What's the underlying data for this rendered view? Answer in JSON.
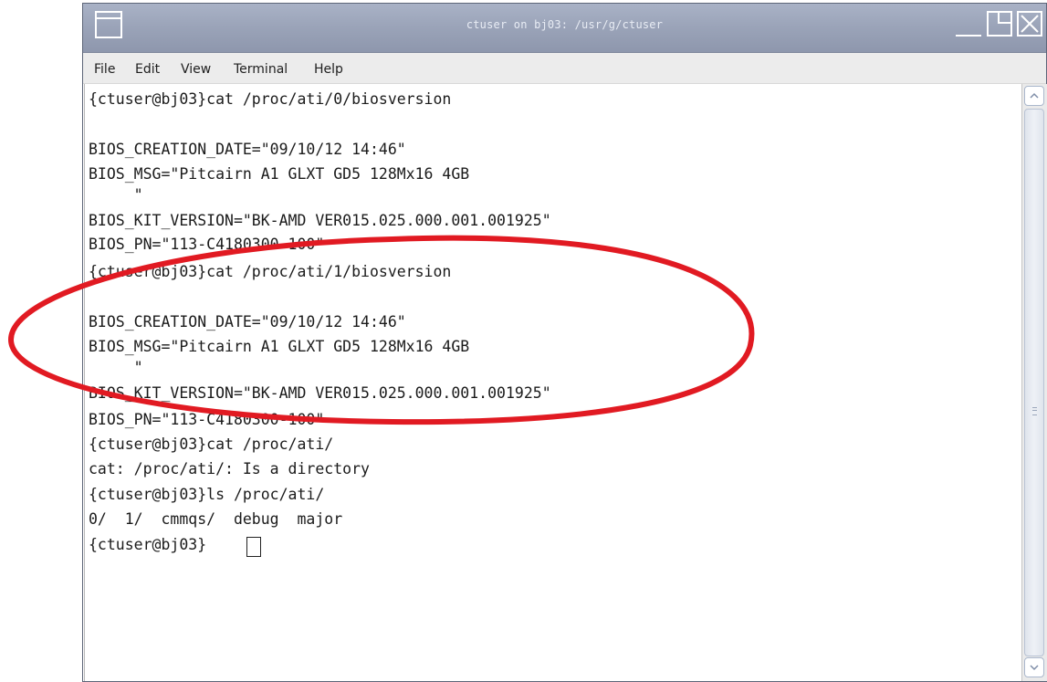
{
  "window": {
    "title": "ctuser on bj03: /usr/g/ctuser"
  },
  "menubar": {
    "items": [
      "File",
      "Edit",
      "View",
      "Terminal",
      "Help"
    ]
  },
  "terminal": {
    "lines": [
      "{ctuser@bj03}cat /proc/ati/0/biosversion",
      "",
      "BIOS_CREATION_DATE=\"09/10/12 14:46\"",
      "BIOS_MSG=\"Pitcairn A1 GLXT GD5 128Mx16 4GB",
      "     \"",
      "BIOS_KIT_VERSION=\"BK-AMD VER015.025.000.001.001925\"",
      "BIOS_PN=\"113-C4180300-100\"",
      "{ctuser@bj03}cat /proc/ati/1/biosversion",
      "",
      "BIOS_CREATION_DATE=\"09/10/12 14:46\"",
      "BIOS_MSG=\"Pitcairn A1 GLXT GD5 128Mx16 4GB",
      "     \"",
      "BIOS_KIT_VERSION=\"BK-AMD VER015.025.000.001.001925\"",
      "BIOS_PN=\"113-C4180300-100\"",
      "{ctuser@bj03}cat /proc/ati/",
      "cat: /proc/ati/: Is a directory",
      "{ctuser@bj03}ls /proc/ati/",
      "0/  1/  cmmqs/  debug  major",
      "{ctuser@bj03}"
    ]
  },
  "colors": {
    "titlebar": "#9aa3b8",
    "annotation_ellipse": "#e11a22",
    "text": "#1b1b1b"
  }
}
